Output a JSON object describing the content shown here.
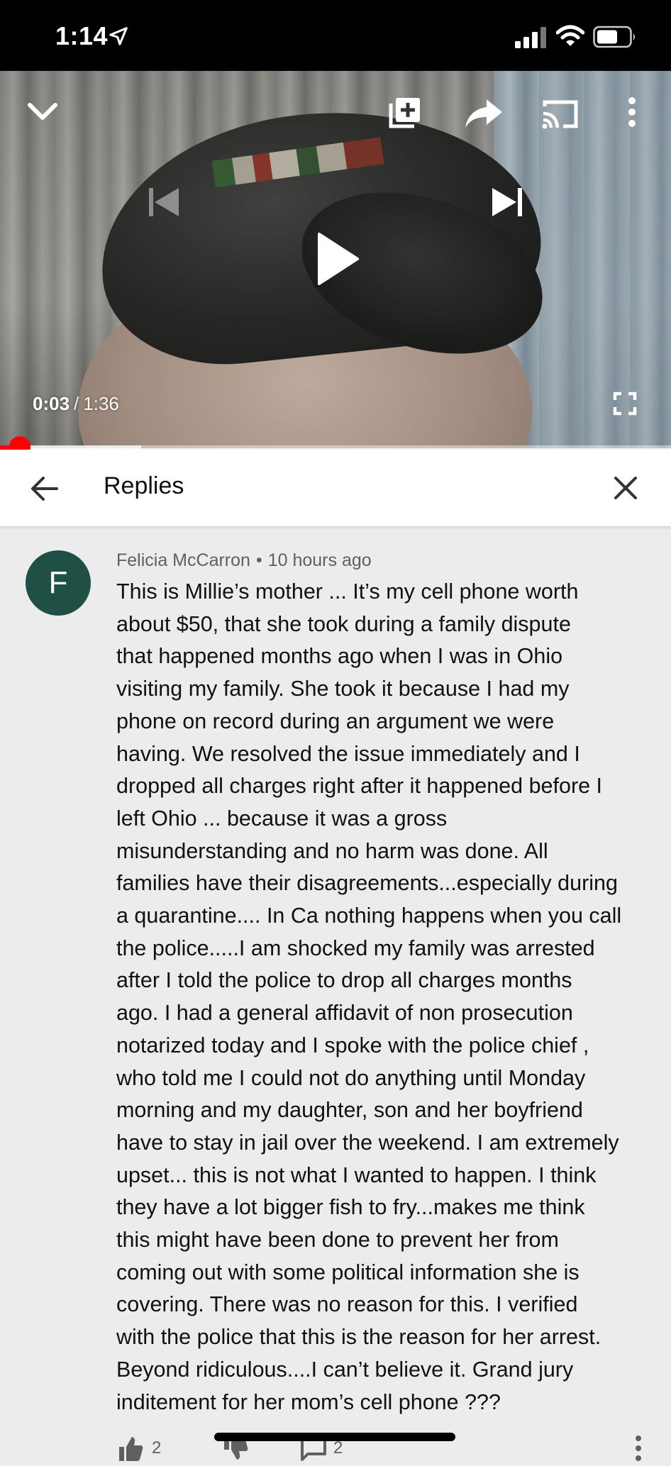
{
  "status_bar": {
    "time": "1:14"
  },
  "player": {
    "current_time": "0:03",
    "separator": "/",
    "duration": "1:36",
    "progress_played": 0.03,
    "progress_buffered": 0.21
  },
  "replies_header": {
    "title": "Replies"
  },
  "comment": {
    "avatar_letter": "F",
    "author": "Felicia McCarron",
    "time_ago": "10 hours ago",
    "text": "This is Millie’s mother ... It’s my cell phone worth\nabout $50,  that she took during a family dispute\nthat happened months ago when I was in Ohio\nvisiting my family. She took it because I had my\nphone on record during an argument we were\nhaving. We resolved the issue immediately and I\ndropped all charges right after it happened before I\nleft Ohio ... because it was a gross\nmisunderstanding and no harm was done. All\nfamilies have their disagreements...especially during\na quarantine.... In Ca nothing happens when you call\nthe police.....I am shocked my family was arrested\nafter I told the police to drop all charges months\nago. I had a general affidavit of non prosecution\nnotarized today and I spoke with the police chief ,\nwho told me I could not do anything until Monday\nmorning and my daughter, son and her boyfriend\nhave to stay in jail over the weekend. I am extremely\nupset... this is not what I wanted to happen. I think\nthey have a lot bigger fish to fry...makes me think\nthis might have been done to prevent her from\ncoming out with some political information she is\ncovering. There was no reason for this. I verified\nwith the police that this is the reason for her arrest.\nBeyond ridiculous....I can’t believe it. Grand jury\ninditement for her mom’s cell phone ???",
    "like_count": "2",
    "reply_count": "2"
  },
  "colors": {
    "accent_red": "#ff0000",
    "avatar_bg": "#1f4f45",
    "panel_bg": "#ececec"
  },
  "icons": [
    "location-arrow-icon",
    "cellular-signal-icon",
    "wifi-icon",
    "battery-icon",
    "chevron-down-icon",
    "add-to-playlist-icon",
    "share-icon",
    "cast-icon",
    "more-vert-icon",
    "previous-icon",
    "play-icon",
    "next-icon",
    "fullscreen-icon",
    "back-arrow-icon",
    "close-icon",
    "thumb-up-icon",
    "thumb-down-icon",
    "reply-icon"
  ]
}
